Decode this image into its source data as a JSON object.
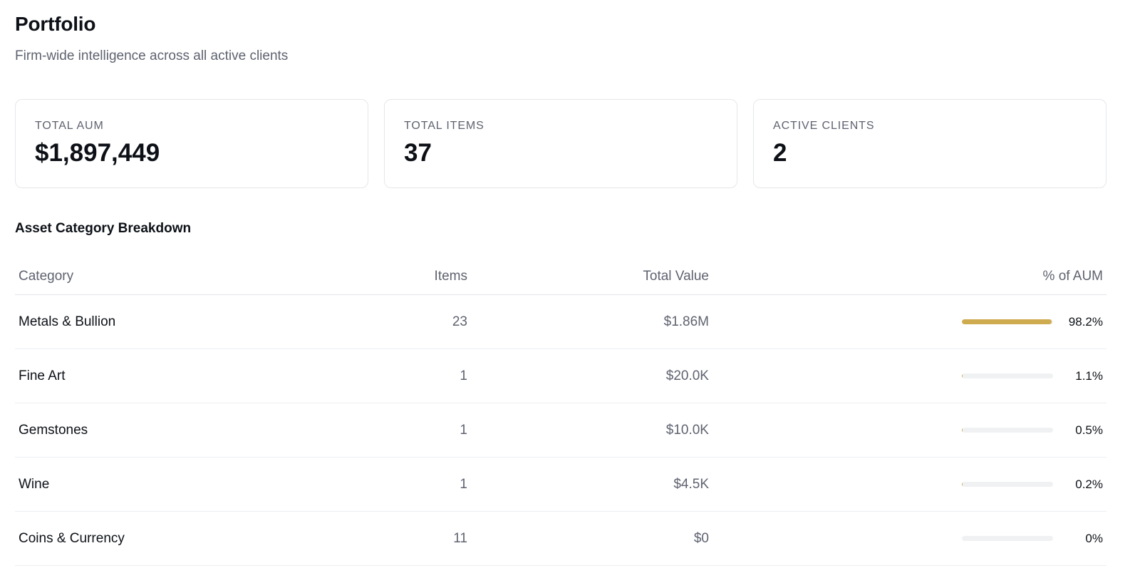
{
  "header": {
    "title": "Portfolio",
    "subtitle": "Firm-wide intelligence across all active clients"
  },
  "stats": [
    {
      "label": "TOTAL AUM",
      "value": "$1,897,449"
    },
    {
      "label": "TOTAL ITEMS",
      "value": "37"
    },
    {
      "label": "ACTIVE CLIENTS",
      "value": "2"
    }
  ],
  "breakdown": {
    "title": "Asset Category Breakdown",
    "columns": {
      "category": "Category",
      "items": "Items",
      "total_value": "Total Value",
      "pct_aum": "% of AUM"
    },
    "rows": [
      {
        "category": "Metals & Bullion",
        "items": "23",
        "total_value": "$1.86M",
        "pct": "98.2%",
        "pct_value": 98.2
      },
      {
        "category": "Fine Art",
        "items": "1",
        "total_value": "$20.0K",
        "pct": "1.1%",
        "pct_value": 1.1
      },
      {
        "category": "Gemstones",
        "items": "1",
        "total_value": "$10.0K",
        "pct": "0.5%",
        "pct_value": 0.5
      },
      {
        "category": "Wine",
        "items": "1",
        "total_value": "$4.5K",
        "pct": "0.2%",
        "pct_value": 0.2
      },
      {
        "category": "Coins & Currency",
        "items": "11",
        "total_value": "$0",
        "pct": "0%",
        "pct_value": 0
      }
    ]
  },
  "colors": {
    "accent": "#cfab4f",
    "track": "#f0f1f3",
    "muted_text": "#5f6370",
    "border": "#e6e7ea"
  }
}
